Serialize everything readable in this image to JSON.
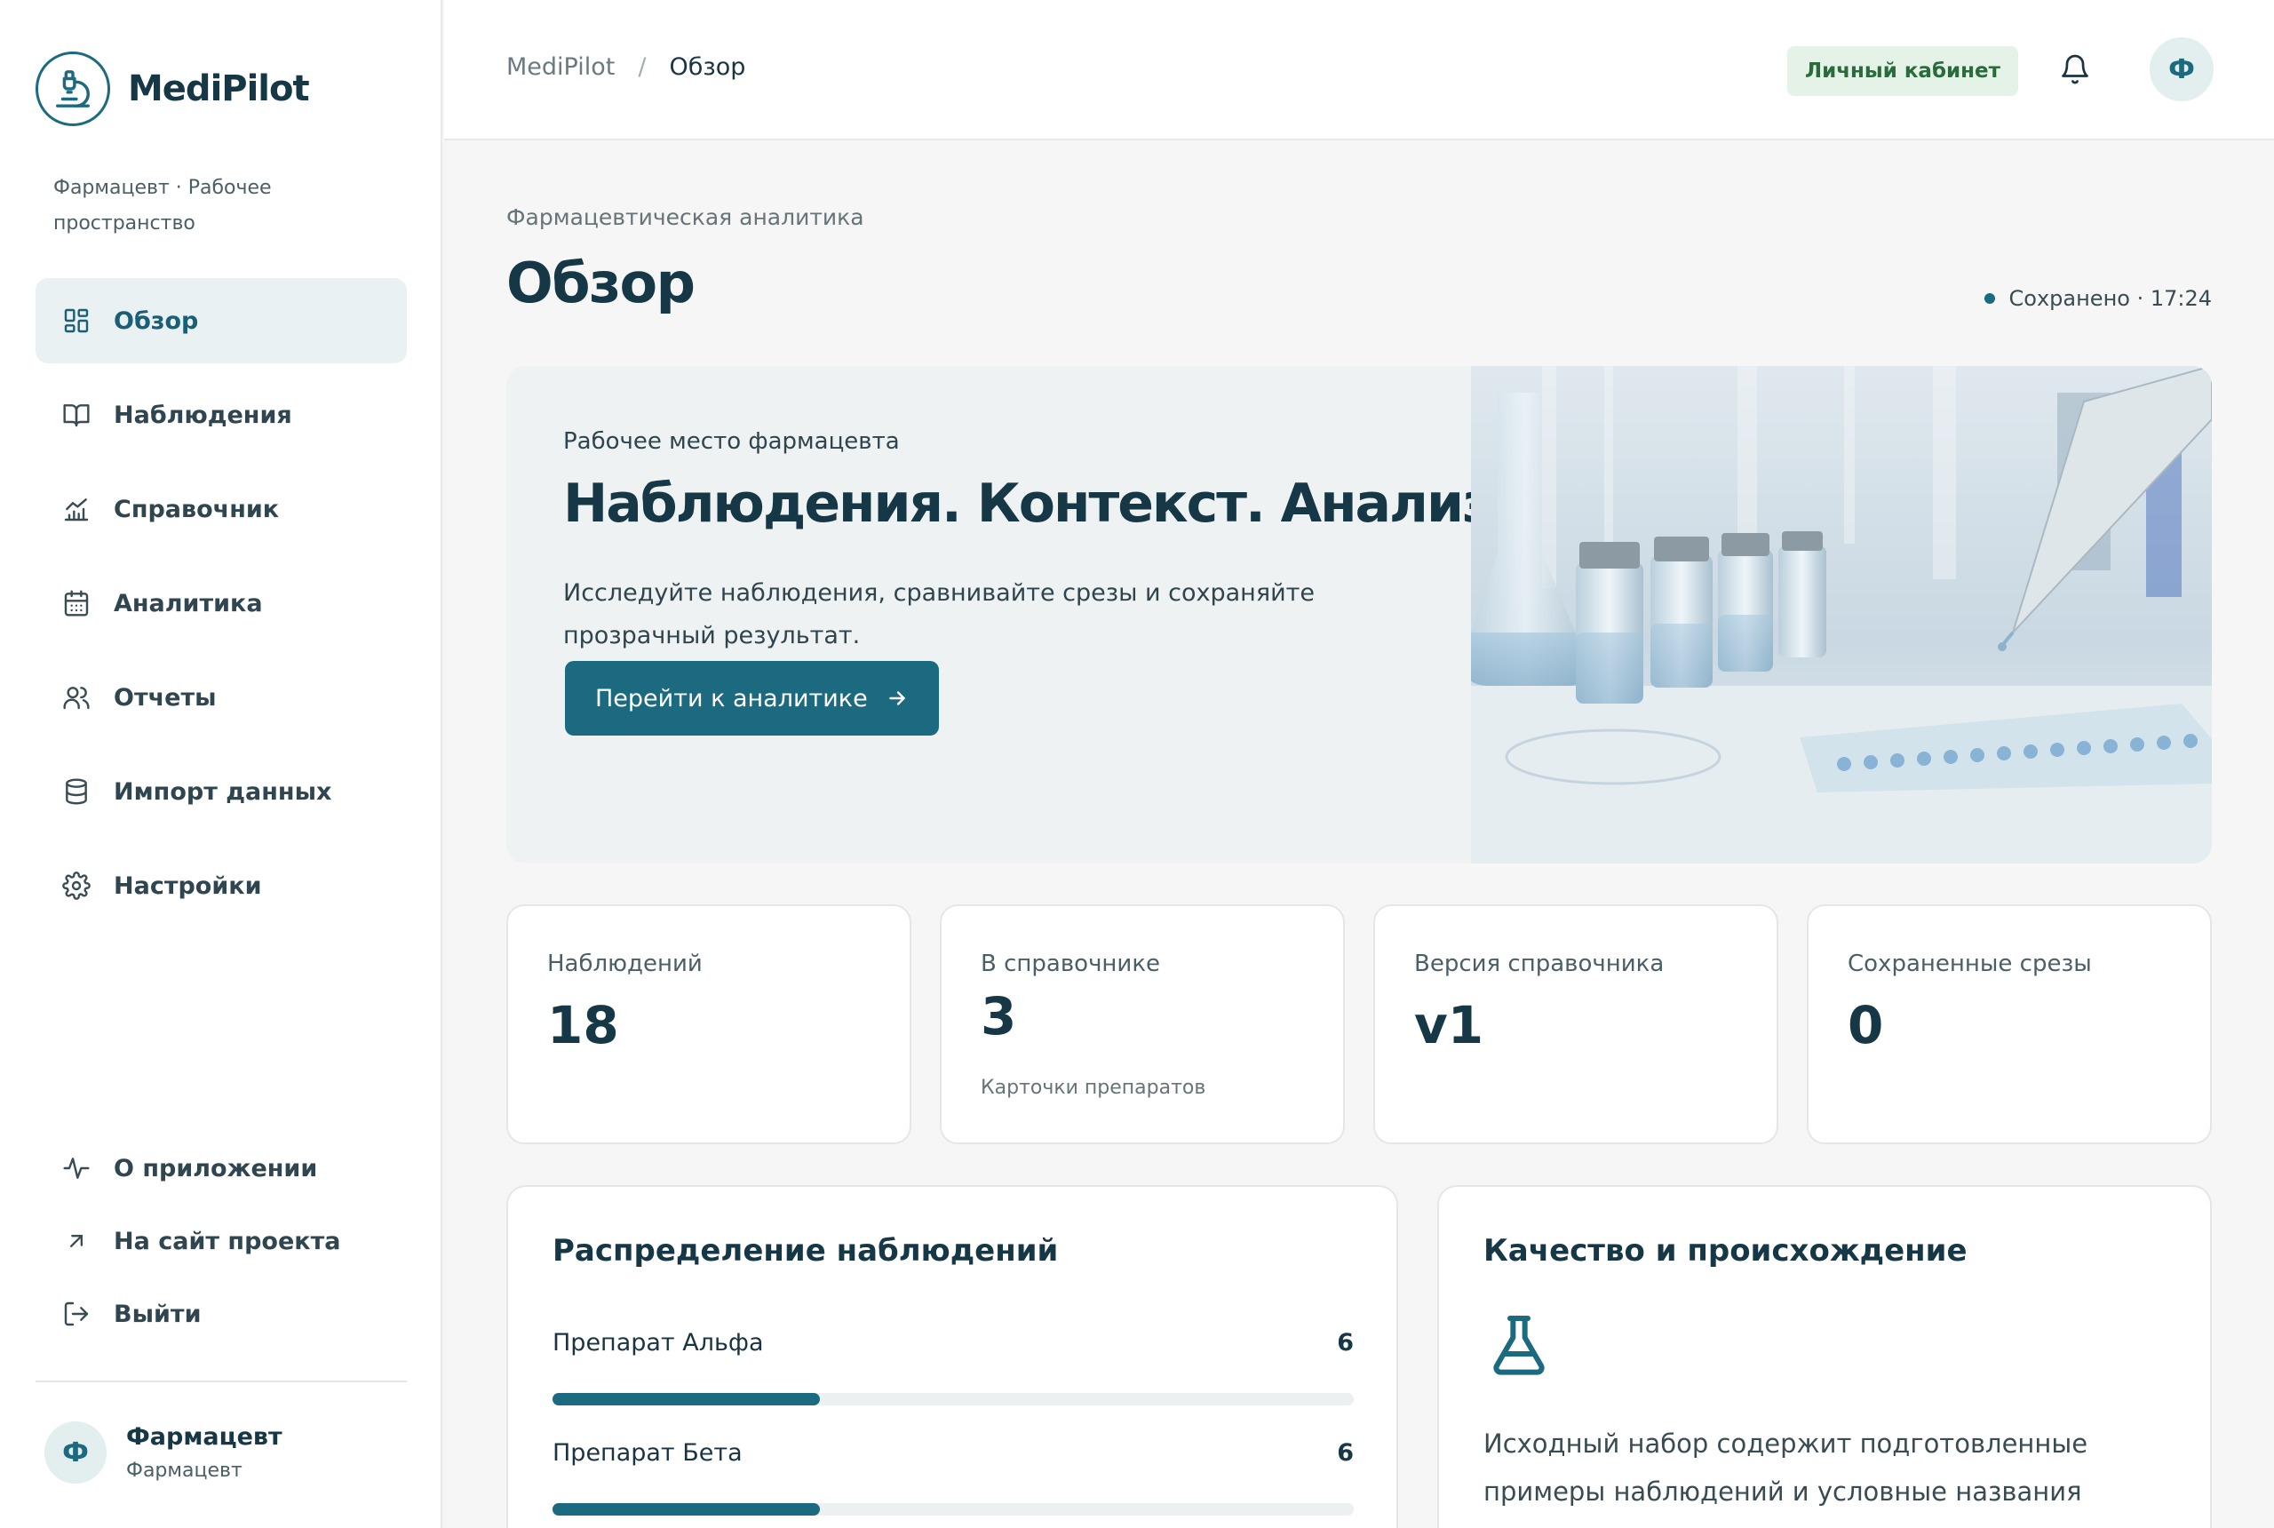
{
  "brand": {
    "name": "MediPilot",
    "workspace": "Фармацевт · Рабочее пространство"
  },
  "nav": {
    "items": [
      {
        "label": "Обзор",
        "icon": "grid-icon",
        "active": true
      },
      {
        "label": "Наблюдения",
        "icon": "book-icon"
      },
      {
        "label": "Справочник",
        "icon": "chart-icon"
      },
      {
        "label": "Аналитика",
        "icon": "calendar-icon"
      },
      {
        "label": "Отчеты",
        "icon": "users-icon"
      },
      {
        "label": "Импорт данных",
        "icon": "database-icon"
      },
      {
        "label": "Настройки",
        "icon": "gear-icon"
      }
    ],
    "bottom": [
      {
        "label": "О приложении",
        "icon": "activity-icon"
      },
      {
        "label": "На сайт проекта",
        "icon": "arrow-up-right-icon"
      },
      {
        "label": "Выйти",
        "icon": "logout-icon"
      }
    ]
  },
  "user": {
    "initial": "Ф",
    "name": "Фармацевт",
    "role": "Фармацевт"
  },
  "topbar": {
    "breadcrumb": [
      "MediPilot",
      "Обзор"
    ],
    "separator": "/",
    "cabinet": "Личный кабинет",
    "avatar_initial": "Ф"
  },
  "page": {
    "eyebrow": "Фармацевтическая аналитика",
    "title": "Обзор",
    "saved": "Сохранено · 17:24"
  },
  "hero": {
    "subtitle": "Рабочее место фармацевта",
    "headline": "Наблюдения. Контекст. Анализ.",
    "description": "Исследуйте наблюдения, сравнивайте срезы и сохраняйте прозрачный результат.",
    "button": "Перейти к аналитике"
  },
  "stats": [
    {
      "label": "Наблюдений",
      "value": "18",
      "note": ""
    },
    {
      "label": "В справочнике",
      "value": "3",
      "note": "Карточки препаратов"
    },
    {
      "label": "Версия справочника",
      "value": "v1",
      "note": ""
    },
    {
      "label": "Сохраненные срезы",
      "value": "0",
      "note": ""
    }
  ],
  "distribution": {
    "title": "Распределение наблюдений",
    "max": 18,
    "rows": [
      {
        "name": "Препарат Альфа",
        "count": 6
      },
      {
        "name": "Препарат Бета",
        "count": 6
      }
    ]
  },
  "quality": {
    "title": "Качество и происхождение",
    "text": "Исходный набор содержит подготовленные примеры наблюдений и условные названия"
  },
  "colors": {
    "accent": "#1b6a7f",
    "dark": "#163746",
    "badge_bg": "#e4f2e8",
    "badge_text": "#2a6b3c"
  }
}
